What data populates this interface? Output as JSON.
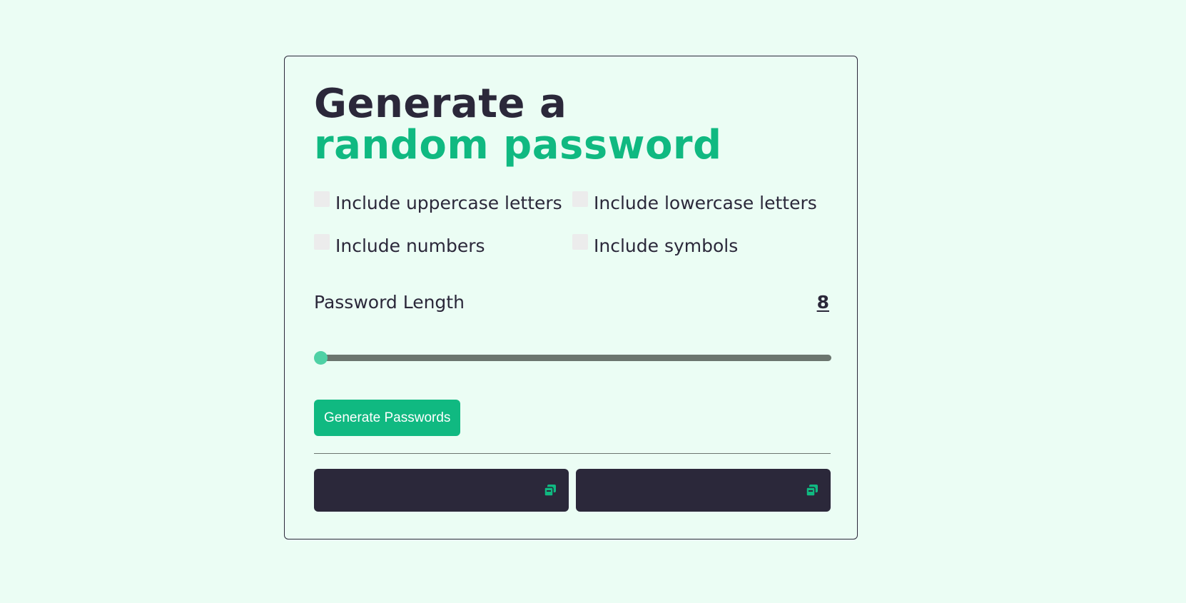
{
  "title": {
    "line1": "Generate a",
    "line2": "random password"
  },
  "options": {
    "uppercase": {
      "label": "Include uppercase letters",
      "checked": false
    },
    "lowercase": {
      "label": "Include lowercase letters",
      "checked": false
    },
    "numbers": {
      "label": "Include numbers",
      "checked": false
    },
    "symbols": {
      "label": "Include symbols",
      "checked": false
    }
  },
  "length": {
    "label": "Password Length",
    "value": "8",
    "slider_fraction": 0.0
  },
  "generate_button": {
    "label": "Generate Passwords"
  },
  "outputs": [
    {
      "value": "",
      "icon": "copy-icon"
    },
    {
      "value": "",
      "icon": "copy-icon"
    }
  ],
  "colors": {
    "background": "#ebfdf4",
    "accent": "#10b981",
    "dark": "#2b283a",
    "slider_thumb": "#4fd1a5",
    "slider_track": "#6b756e"
  }
}
